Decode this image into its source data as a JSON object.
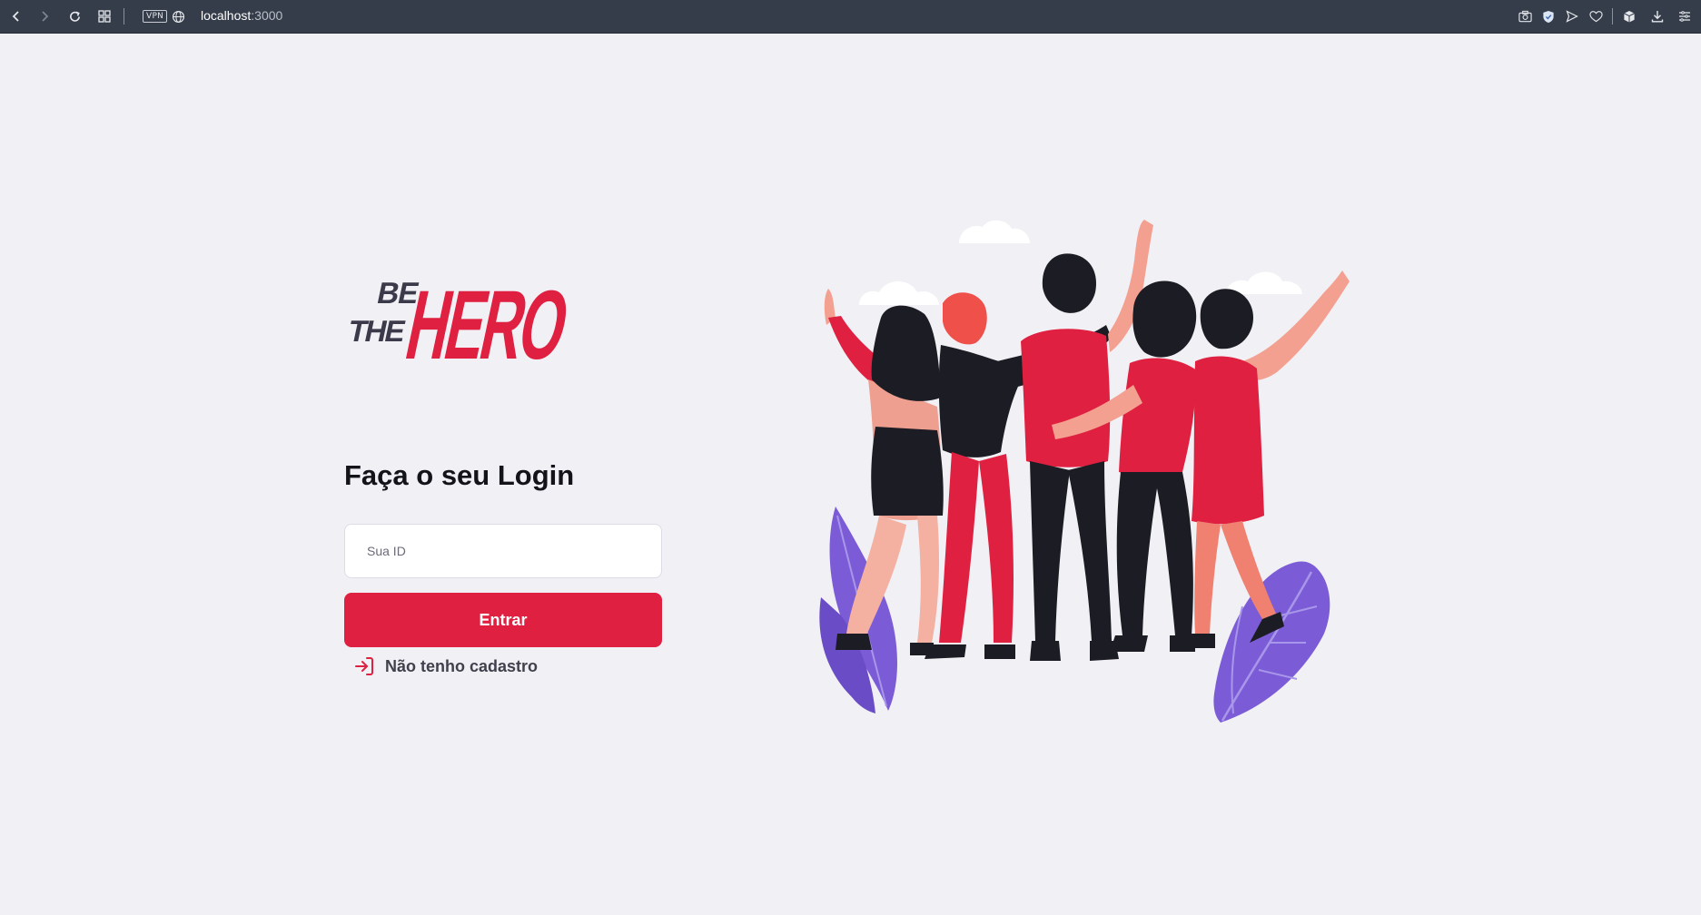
{
  "browser": {
    "url_host": "localhost",
    "url_port": ":3000",
    "vpn_label": "VPN"
  },
  "logo": {
    "line1": "BE",
    "line2": "THE",
    "word": "HERO"
  },
  "login": {
    "title": "Faça o seu Login",
    "id_placeholder": "Sua ID",
    "submit_label": "Entrar",
    "signup_label": "Não tenho cadastro"
  },
  "colors": {
    "accent": "#e02041",
    "background": "#f0f0f5",
    "text_dark": "#13131a",
    "text_muted": "#41414d",
    "browser_bar": "#353d4a",
    "illustration_purple": "#7b5cd6"
  },
  "icons": {
    "back": "chevron-left-icon",
    "forward": "chevron-right-icon",
    "reload": "reload-icon",
    "tabs": "grid-icon",
    "globe": "globe-icon",
    "camera": "camera-icon",
    "shield": "shield-icon",
    "send": "send-icon",
    "heart": "heart-icon",
    "box": "cube-icon",
    "download": "download-icon",
    "menu": "menu-icon",
    "login": "log-in-icon"
  }
}
